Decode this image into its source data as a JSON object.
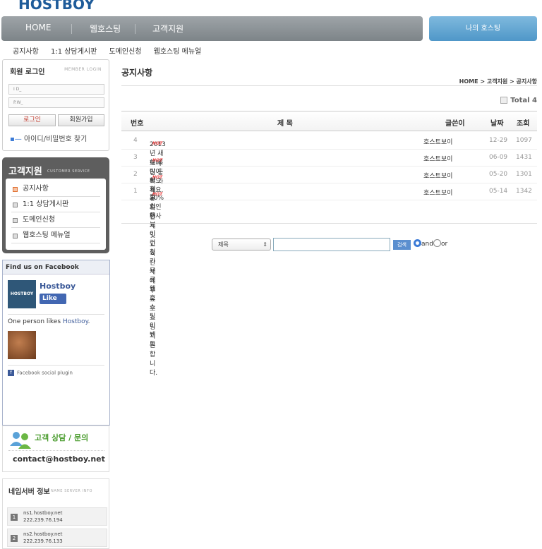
{
  "logo": "HOSTBOY",
  "nav": {
    "items": [
      "HOME",
      "웹호스팅",
      "고객지원"
    ],
    "my_hosting": "나의 호스팅"
  },
  "subnav": [
    "공지사항",
    "1:1 상담게시판",
    "도메인신청",
    "웹호스팅 메뉴얼"
  ],
  "login": {
    "title": "회원 로그인",
    "subtitle": "MEMBER LOGIN",
    "id_placeholder": "I D_",
    "pw_placeholder": "P.W_",
    "login_button": "로그인",
    "join_button": "회원가입",
    "find_link": "아이디/비밀번호 찾기"
  },
  "customer_service": {
    "title": "고객지원",
    "subtitle": "CUSTOMER SERVICE",
    "items": [
      "공지사항",
      "1:1 상담게시판",
      "도메인신청",
      "웹호스팅 메뉴얼"
    ]
  },
  "facebook": {
    "header": "Find us on Facebook",
    "page_name": "Hostboy",
    "logo_text": "HOSTBOY",
    "like": "Like",
    "count_prefix": "One person likes ",
    "count_link": "Hostboy",
    "count_suffix": ".",
    "plugin": "Facebook social plugin",
    "plugin_icon": "f"
  },
  "contact": {
    "title": "고객 상담 / 문의",
    "email": "contact@hostboy.net"
  },
  "nameserver": {
    "title": "네임서버 정보",
    "subtitle": "NAME SERVER INFO",
    "items": [
      {
        "num": "1",
        "host": "ns1.hostboy.net",
        "ip": "222.239.76.194"
      },
      {
        "num": "2",
        "host": "ns2.hostboy.net",
        "ip": "222.239.76.133"
      }
    ]
  },
  "main": {
    "title": "공지사항",
    "breadcrumb": "HOME > 고객지원 > 공지사항",
    "total": "Total 4",
    "columns": {
      "no": "번호",
      "subject": "제   목",
      "writer": "글쓴이",
      "date": "날짜",
      "views": "조회"
    },
    "hot_label": "HOT",
    "rows": [
      {
        "no": "4",
        "subject": "2013년 새해 복 많이 받으세요.",
        "writer": "호스트보이",
        "date": "12-29",
        "views": "1097"
      },
      {
        "no": "3",
        "subject": "도메인 등록 가격 20% 할인행사",
        "writer": "호스트보이",
        "date": "06-09",
        "views": "1431"
      },
      {
        "no": "2",
        "subject": "사회봉사단체 및 교육단체에 무료 호스팅 지원합니다.",
        "writer": "호스트보이",
        "date": "05-20",
        "views": "1301"
      },
      {
        "no": "1",
        "subject": "호스트보이 런칭과 무료 웹호스팅 이벤트",
        "writer": "호스트보이",
        "date": "05-14",
        "views": "1342"
      }
    ]
  },
  "search": {
    "select": "제목",
    "button": "검색",
    "and_label": "and",
    "or_label": "or"
  }
}
